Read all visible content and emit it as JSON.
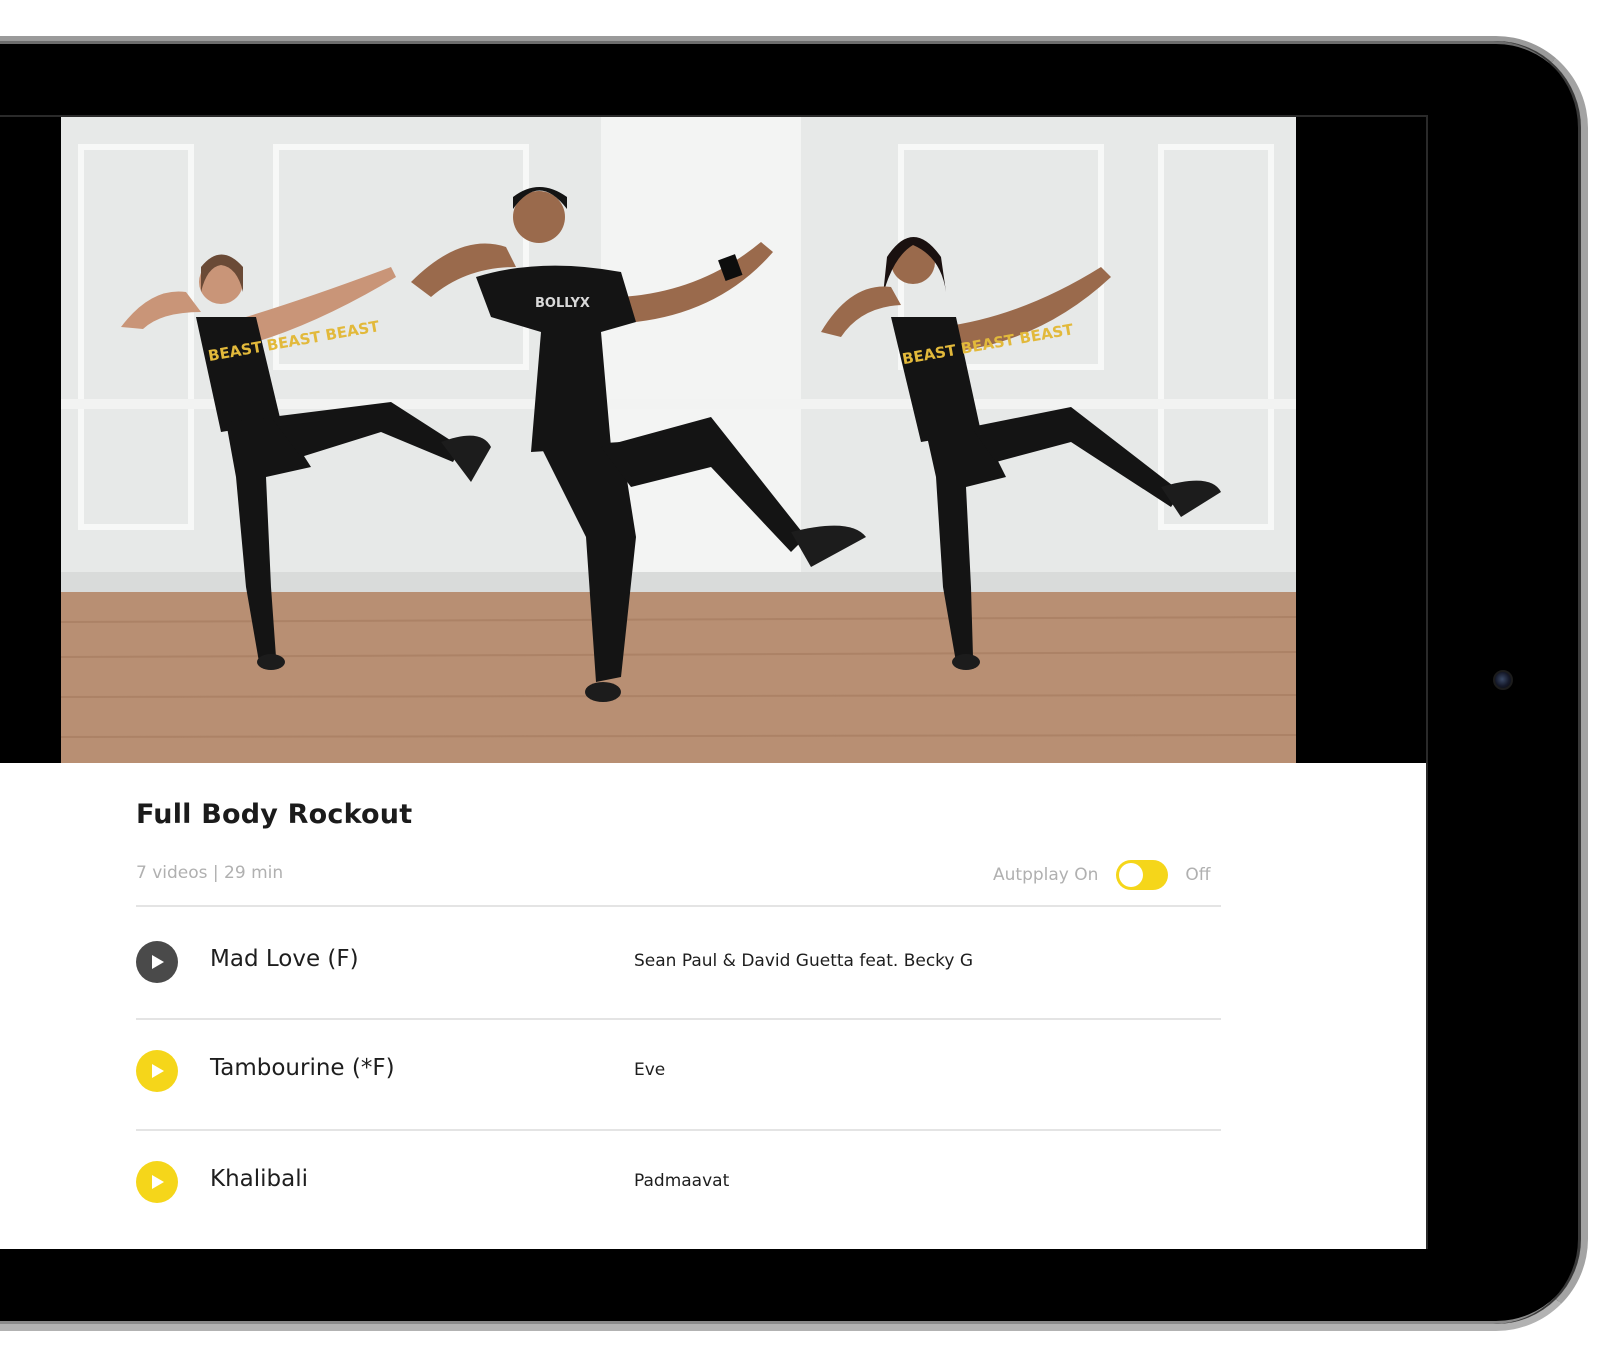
{
  "workout": {
    "title": "Full Body Rockout",
    "meta": "7 videos | 29 min"
  },
  "autoplay": {
    "on_label": "Autpplay On",
    "off_label": "Off",
    "enabled": true
  },
  "tracks": [
    {
      "title": "Mad Love (F)",
      "artist": "Sean Paul & David Guetta feat. Becky G",
      "state": "playing"
    },
    {
      "title": "Tambourine (*F)",
      "artist": "Eve",
      "state": "queued"
    },
    {
      "title": "Khalibali",
      "artist": "Padmaavat",
      "state": "queued"
    }
  ],
  "icons": {
    "play": "play-icon"
  },
  "colors": {
    "accent": "#f5d61a",
    "playing": "#4a4a4a",
    "muted_text": "#b0b0b0",
    "text": "#1e1e1e"
  },
  "video_shirts": {
    "left": "BEAST BEAST BEAST",
    "center": "BOLLYX",
    "right": "BEAST BEAST BEAST"
  }
}
